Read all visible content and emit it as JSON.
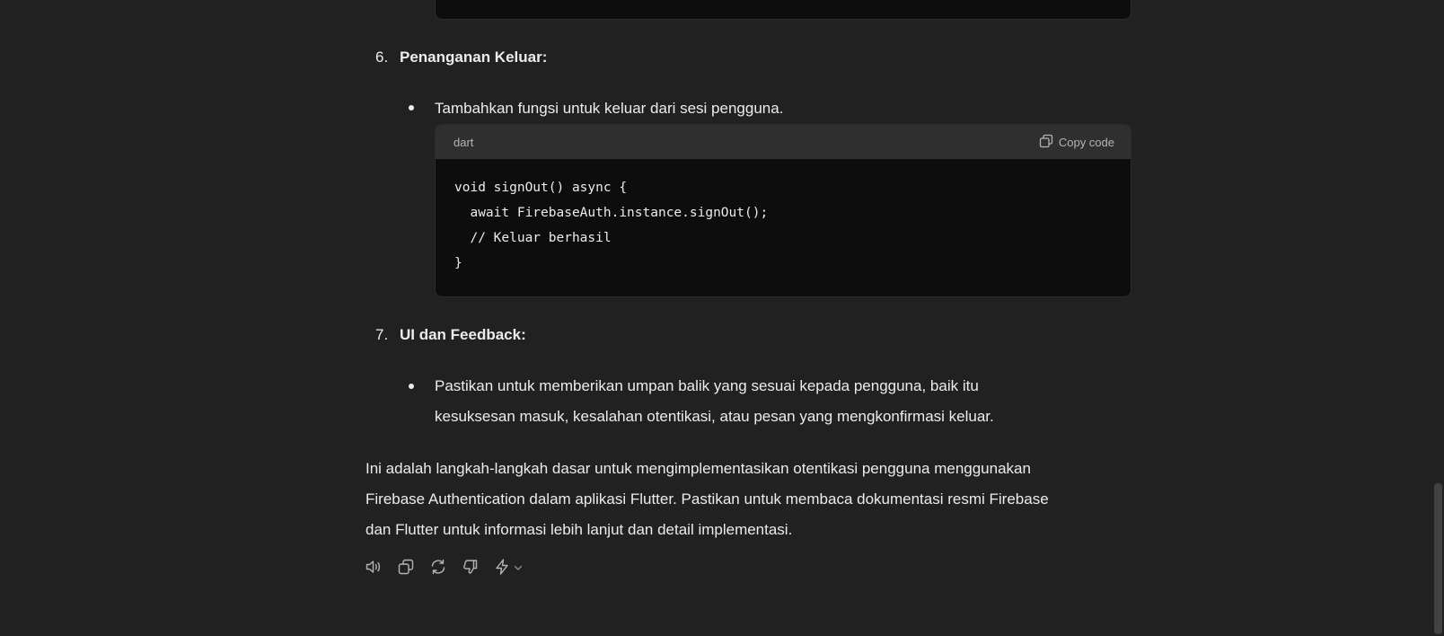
{
  "section6": {
    "number": "6.",
    "title": "Penanganan Keluar:",
    "bullet": "Tambahkan fungsi untuk keluar dari sesi pengguna."
  },
  "code_block": {
    "language": "dart",
    "copy_label": "Copy code",
    "lines": [
      "void signOut() async {",
      "  await FirebaseAuth.instance.signOut();",
      "  // Keluar berhasil",
      "}"
    ]
  },
  "section7": {
    "number": "7.",
    "title": "UI dan Feedback:",
    "bullet_line1": "Pastikan untuk memberikan umpan balik yang sesuai kepada pengguna, baik itu",
    "bullet_line2": "kesuksesan masuk, kesalahan otentikasi, atau pesan yang mengkonfirmasi keluar."
  },
  "closing": {
    "line1": "Ini adalah langkah-langkah dasar untuk mengimplementasikan otentikasi pengguna menggunakan",
    "line2": "Firebase Authentication dalam aplikasi Flutter. Pastikan untuk membaca dokumentasi resmi Firebase",
    "line3": "dan Flutter untuk informasi lebih lanjut dan detail implementasi."
  },
  "actions": {
    "icons": [
      "speaker-icon",
      "copy-icon",
      "regenerate-icon",
      "thumbs-down-icon",
      "lightning-icon",
      "chevron-down-icon"
    ]
  },
  "colors": {
    "background": "#212121",
    "code_background": "#0d0d0d",
    "code_header": "#2f2f2f",
    "text": "#ececec",
    "muted_text": "#b4b4b4"
  }
}
